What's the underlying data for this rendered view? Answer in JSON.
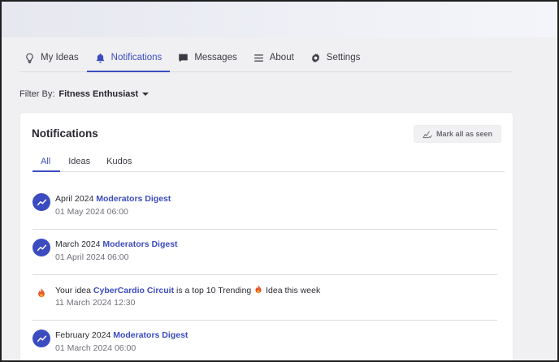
{
  "nav": {
    "items": [
      {
        "label": "My Ideas",
        "icon": "lightbulb-icon"
      },
      {
        "label": "Notifications",
        "icon": "bell-icon",
        "active": true
      },
      {
        "label": "Messages",
        "icon": "chat-icon"
      },
      {
        "label": "About",
        "icon": "menu-icon"
      },
      {
        "label": "Settings",
        "icon": "gear-icon"
      }
    ]
  },
  "filter": {
    "label": "Filter By:",
    "value": "Fitness Enthusiast"
  },
  "card": {
    "title": "Notifications",
    "mark_all_label": "Mark all as seen",
    "tabs": [
      {
        "label": "All",
        "active": true
      },
      {
        "label": "Ideas"
      },
      {
        "label": "Kudos"
      }
    ]
  },
  "notifications": [
    {
      "prefix": "April 2024",
      "link": "Moderators Digest",
      "date": "01 May 2024 06:00",
      "icon": "trending-icon"
    },
    {
      "prefix": "March 2024",
      "link": "Moderators Digest",
      "date": "01 April 2024 06:00",
      "icon": "trending-icon"
    },
    {
      "prefix": "Your idea",
      "link": "CyberCardio Circuit",
      "suffix_a": "is a top 10 Trending",
      "suffix_b": "Idea this week",
      "date": "11 March 2024 12:30",
      "icon": "fire-icon"
    },
    {
      "prefix": "February 2024",
      "link": "Moderators Digest",
      "date": "01 March 2024 06:00",
      "icon": "trending-icon"
    }
  ],
  "colors": {
    "accent": "#3b4cc0",
    "fire": "#e8562a"
  }
}
